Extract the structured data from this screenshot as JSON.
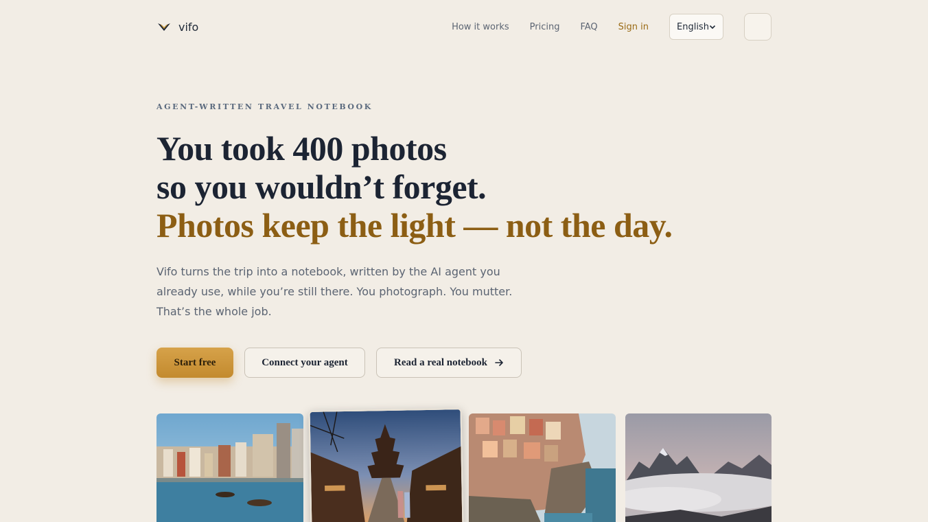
{
  "brand": {
    "name": "vifo",
    "icon": "vifo-wing-logo"
  },
  "nav": {
    "links": [
      "How it works",
      "Pricing",
      "FAQ"
    ],
    "signin": "Sign in",
    "language": "English",
    "theme_toggle_icon": "theme-toggle"
  },
  "hero": {
    "eyebrow": "AGENT-WRITTEN TRAVEL NOTEBOOK",
    "headline_line1": "You took 400 photos",
    "headline_line2": "so you wouldn’t forget.",
    "headline_accent": "Photos keep the light — not the day.",
    "lede": "Vifo turns the trip into a notebook, written by the AI agent you already use, while you’re still there. You photograph. You mutter. That’s the whole job.",
    "cta_primary": "Start free",
    "cta_connect": "Connect your agent",
    "cta_read": "Read a real notebook"
  },
  "colors": {
    "background": "#f2ede5",
    "accent": "#8c5e14",
    "primary_button": "#d6a24a",
    "text": "#1c2433"
  },
  "photos": [
    {
      "scene": "riverside-town-photo"
    },
    {
      "scene": "pagoda-street-photo"
    },
    {
      "scene": "cliffside-village-photo"
    },
    {
      "scene": "mountain-clouds-photo"
    }
  ]
}
